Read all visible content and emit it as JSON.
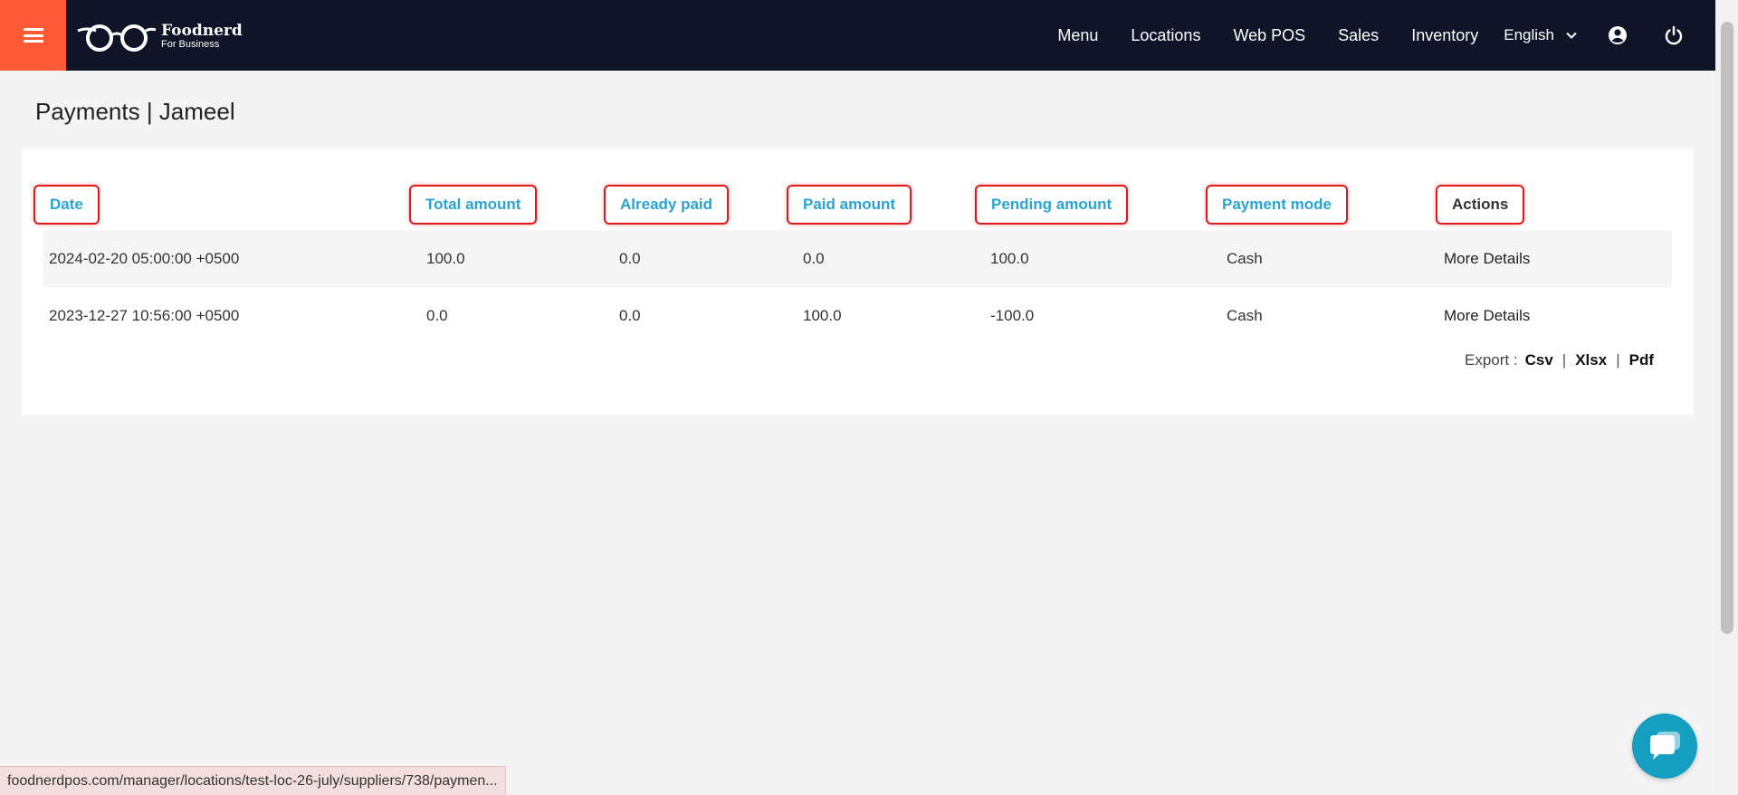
{
  "navbar": {
    "brand_name": "Foodnerd",
    "brand_sub": "For Business",
    "links": [
      "Menu",
      "Locations",
      "Web POS",
      "Sales",
      "Inventory"
    ],
    "language": "English",
    "accent_color": "#ff5a36",
    "bg_color": "#0f1426",
    "icons": [
      "menu-icon",
      "glasses-logo",
      "chevron-down-icon",
      "account-icon",
      "power-icon"
    ]
  },
  "page": {
    "title": "Payments | Jameel"
  },
  "table": {
    "headers": [
      "Date",
      "Total amount",
      "Already paid",
      "Paid amount",
      "Pending amount",
      "Payment mode",
      "Actions"
    ],
    "rows": [
      [
        "2024-02-20 05:00:00 +0500",
        "100.0",
        "0.0",
        "0.0",
        "100.0",
        "Cash",
        "More Details"
      ],
      [
        "2023-12-27 10:56:00 +0500",
        "0.0",
        "0.0",
        "100.0",
        "-100.0",
        "Cash",
        "More Details"
      ]
    ],
    "header_color": "#2aa3d4",
    "highlight_color": "#e01818"
  },
  "export": {
    "label": "Export :",
    "csv": "Csv",
    "xlsx": "Xlsx",
    "pdf": "Pdf",
    "sep": "|"
  },
  "status_url": "foodnerdpos.com/manager/locations/test-loc-26-july/suppliers/738/paymen...",
  "chat": {
    "icon": "chat-bubble-icon",
    "color": "#159dc2"
  }
}
